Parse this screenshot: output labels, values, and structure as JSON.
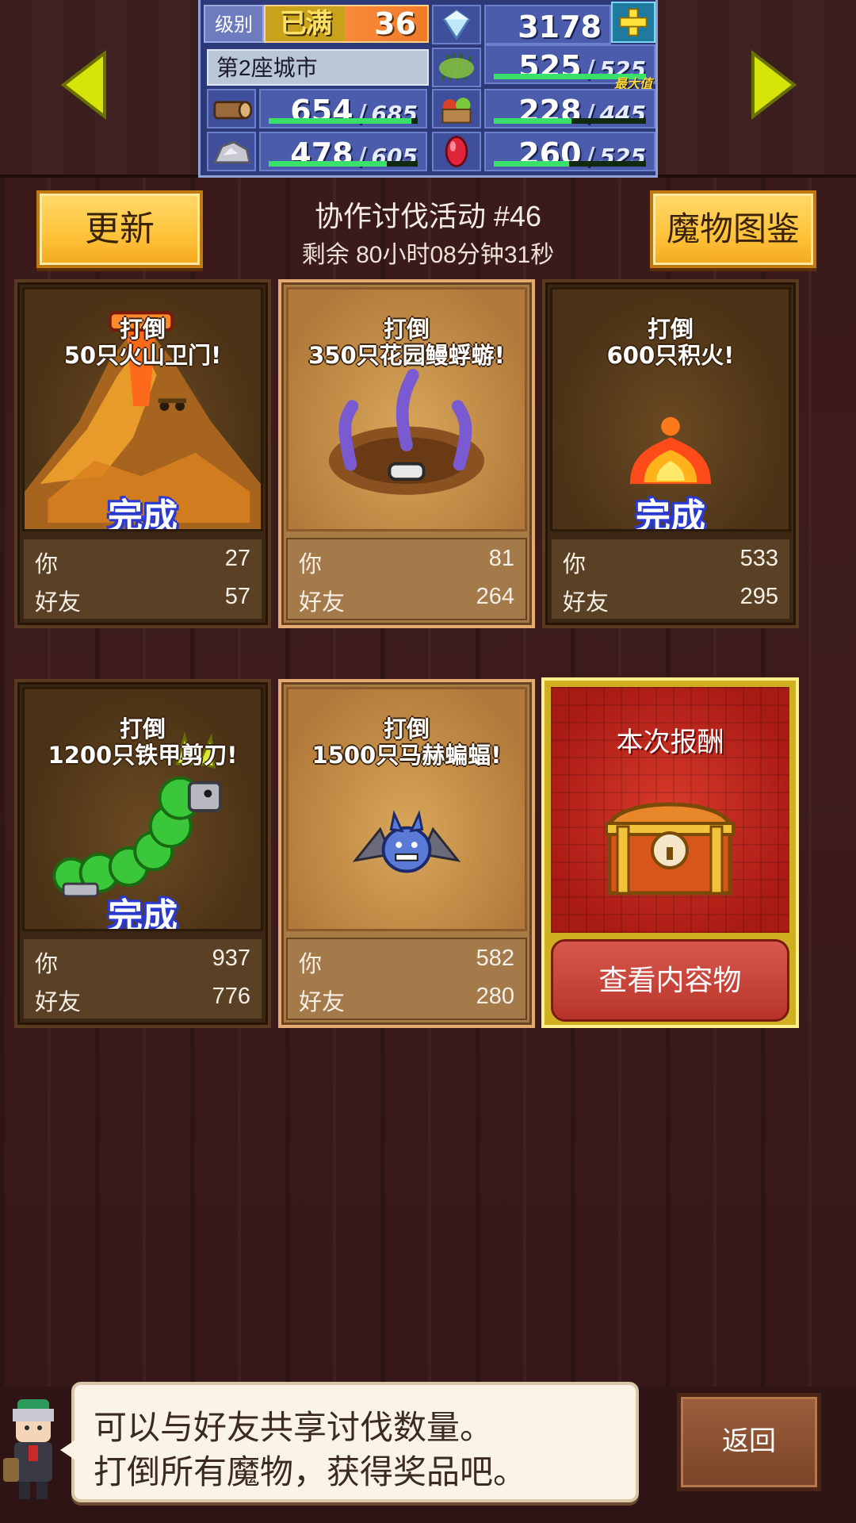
{
  "status_bar": {
    "level_label": "级别",
    "level_max_badge": "已满",
    "level": "36",
    "gems": "3178",
    "city": "第2座城市",
    "max_tag": "最大值",
    "resources": [
      {
        "icon": "grass-icon",
        "current": "525",
        "cap": "525",
        "fill": 1.0
      },
      {
        "icon": "wood-log-icon",
        "current": "654",
        "cap": "685",
        "fill": 0.955
      },
      {
        "icon": "food-basket-icon",
        "current": "228",
        "cap": "445",
        "fill": 0.51
      },
      {
        "icon": "stone-ore-icon",
        "current": "478",
        "cap": "605",
        "fill": 0.79
      },
      {
        "icon": "ruby-icon",
        "current": "260",
        "cap": "525",
        "fill": 0.495
      }
    ],
    "slash": "/"
  },
  "header": {
    "refresh_label": "更新",
    "bestiary_label": "魔物图鉴",
    "event_title": "协作讨伐活动 #46",
    "timer": "剩余 80小时08分钟31秒"
  },
  "labels": {
    "you": "你",
    "friends": "好友",
    "done": "完成"
  },
  "missions": [
    {
      "goal_line1": "打倒",
      "goal_line2": "50只火山卫门!",
      "you": "27",
      "friends": "57",
      "done": true,
      "monster": "volcano-monster-icon"
    },
    {
      "goal_line1": "打倒",
      "goal_line2": "350只花园鳗蜉蝣!",
      "you": "81",
      "friends": "264",
      "done": false,
      "monster": "garden-eel-icon"
    },
    {
      "goal_line1": "打倒",
      "goal_line2": "600只积火!",
      "you": "533",
      "friends": "295",
      "done": true,
      "monster": "fire-spirit-icon"
    },
    {
      "goal_line1": "打倒",
      "goal_line2": "1200只铁甲剪刀!",
      "you": "937",
      "friends": "776",
      "done": true,
      "monster": "armored-caterpillar-icon"
    },
    {
      "goal_line1": "打倒",
      "goal_line2": "1500只马赫蝙蝠!",
      "you": "582",
      "friends": "280",
      "done": false,
      "monster": "mach-bat-icon"
    }
  ],
  "reward": {
    "title": "本次报酬",
    "button": "查看内容物"
  },
  "hint": {
    "line1": "可以与好友共享讨伐数量。",
    "line2": "打倒所有魔物，获得奖品吧。"
  },
  "back_label": "返回",
  "colors": {
    "accent_gold": "#ffc23a",
    "done_blue": "#2a3ad0",
    "bar_green": "#39e06a",
    "reward_red": "#b8342a"
  }
}
